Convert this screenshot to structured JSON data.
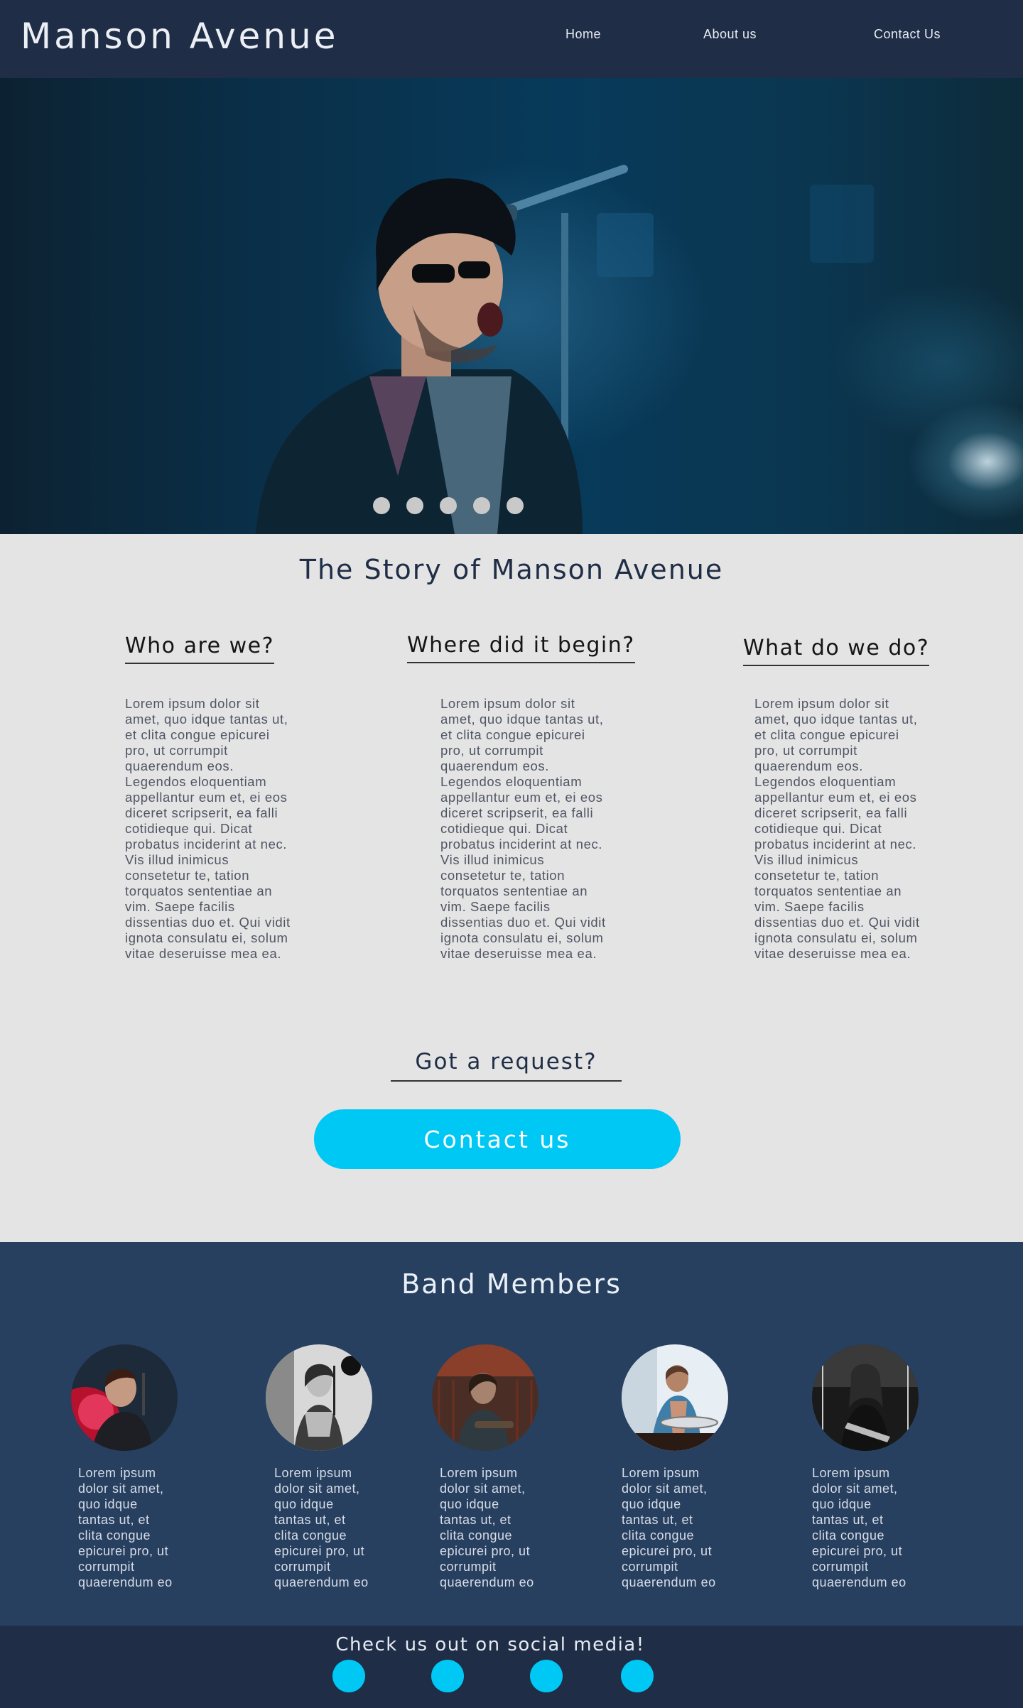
{
  "header": {
    "brand": "Manson Avenue",
    "nav": {
      "home": "Home",
      "about": "About us",
      "contact": "Contact Us"
    }
  },
  "hero": {
    "slide_count": 5
  },
  "story": {
    "title": "The Story of Manson Avenue",
    "columns": [
      {
        "heading": "Who are we?",
        "text": "Lorem ipsum dolor sit amet, quo idque tantas ut, et clita congue epicurei pro, ut corrumpit quaerendum eos. Legendos eloquentiam appellantur eum et, ei eos diceret scripserit, ea falli cotidieque qui. Dicat probatus inciderint at nec. Vis illud inimicus consetetur te, tation torquatos sententiae an vim. Saepe facilis dissentias duo et. Qui vidit ignota consulatu ei, solum vitae deseruisse mea ea."
      },
      {
        "heading": "Where did it begin?",
        "text": "Lorem ipsum dolor sit amet, quo idque tantas ut, et clita congue epicurei pro, ut corrumpit quaerendum eos. Legendos eloquentiam appellantur eum et, ei eos diceret scripserit, ea falli cotidieque qui. Dicat probatus inciderint at nec. Vis illud inimicus consetetur te, tation torquatos sententiae an vim. Saepe facilis dissentias duo et. Qui vidit ignota consulatu ei, solum vitae deseruisse mea ea."
      },
      {
        "heading": "What do we do?",
        "text": "Lorem ipsum dolor sit amet, quo idque tantas ut, et clita congue epicurei pro, ut corrumpit quaerendum eos. Legendos eloquentiam appellantur eum et, ei eos diceret scripserit, ea falli cotidieque qui. Dicat probatus inciderint at nec. Vis illud inimicus consetetur te, tation torquatos sententiae an vim. Saepe facilis dissentias duo et. Qui vidit ignota consulatu ei, solum vitae deseruisse mea ea."
      }
    ],
    "request_heading": "Got a request?",
    "contact_button": "Contact us"
  },
  "band": {
    "title": "Band Members",
    "members": [
      {
        "text": "Lorem ipsum dolor sit amet, quo idque tantas ut, et clita congue epicurei pro, ut corrumpit quaerendum eo"
      },
      {
        "text": "Lorem ipsum dolor sit amet, quo idque tantas ut, et clita congue epicurei pro, ut corrumpit quaerendum eo"
      },
      {
        "text": "Lorem ipsum dolor sit amet, quo idque tantas ut, et clita congue epicurei pro, ut corrumpit quaerendum eo"
      },
      {
        "text": "Lorem ipsum dolor sit amet, quo idque tantas ut, et clita congue epicurei pro, ut corrumpit quaerendum eo"
      },
      {
        "text": "Lorem ipsum dolor sit amet, quo idque tantas ut, et clita congue epicurei pro, ut corrumpit quaerendum eo"
      }
    ]
  },
  "footer": {
    "social_title": "Check us out on social media!",
    "social_count": 4
  },
  "colors": {
    "header_bg": "#1f2d47",
    "page_bg": "#e4e4e4",
    "band_bg": "#28405f",
    "accent": "#00c8f4"
  }
}
